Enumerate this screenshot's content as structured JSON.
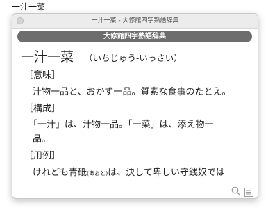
{
  "source_word": "一汁一菜",
  "window": {
    "title": "一汁一菜 - 大修館四字熟語辞典"
  },
  "dictionary_tab": "大修館四字熟語辞典",
  "entry": {
    "headword": "一汁一菜",
    "reading": "（いちじゅう-いっさい）",
    "meaning_label": "［意味］",
    "meaning_text": "汁物一品と、おかず一品。質素な食事のたとえ。",
    "structure_label": "［構成］",
    "structure_text_1": "「一汁」は、汁物一品。「一菜」は、添え物一",
    "structure_text_2": "品。",
    "example_label": "［用例］",
    "example_text_before": "けれども青砥",
    "example_furigana": "(あおと)",
    "example_text_after": "は、決して卑しい守銭奴では"
  },
  "icons": {
    "zoom": "zoom-in-icon",
    "list": "list-icon"
  }
}
